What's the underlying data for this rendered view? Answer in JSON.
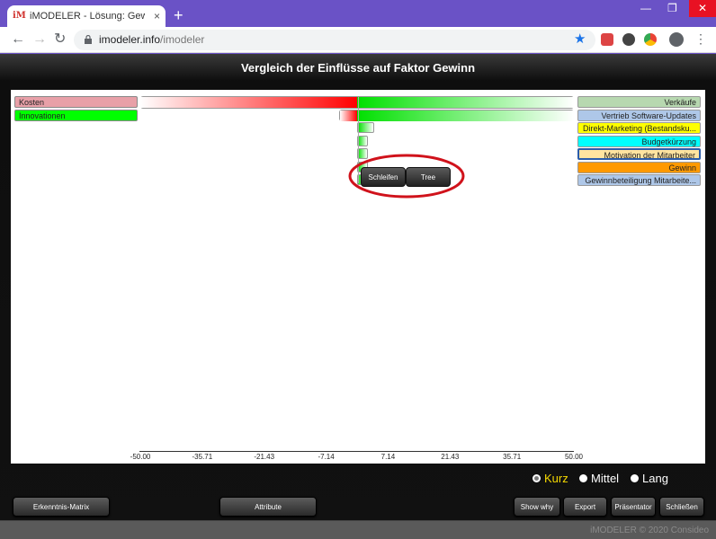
{
  "browser": {
    "tab_title": "iMODELER - Lösung: Gewinn (Ge",
    "tab_close": "×",
    "new_tab": "+",
    "url_host": "imodeler.info",
    "url_path": "/imodeler",
    "favicon_text": "iM"
  },
  "app": {
    "title": "Vergleich der Einflüsse auf Faktor Gewinn",
    "left_labels": [
      {
        "label": "Kosten",
        "color": "#e8a0a8"
      },
      {
        "label": "Innovationen",
        "color": "#00ff00"
      }
    ],
    "right_labels": [
      {
        "label": "Verkäufe",
        "color": "#b7d8b0"
      },
      {
        "label": "Vertrieb Software-Updates",
        "color": "#aec7e8"
      },
      {
        "label": "Direkt-Marketing (Bestandsku...",
        "color": "#ffff00"
      },
      {
        "label": "Budgetkürzung",
        "color": "#00ffff"
      },
      {
        "label": "Motivation der Mitarbeiter",
        "color": "#ffe4a0"
      },
      {
        "label": "Gewinn",
        "color": "#ff9900"
      },
      {
        "label": "Gewinnbeteiligung Mitarbeite...",
        "color": "#aec7e8"
      }
    ],
    "context_buttons": [
      "Schleifen",
      "Tree"
    ],
    "timeframes": [
      {
        "label": "Kurz",
        "selected": true
      },
      {
        "label": "Mittel",
        "selected": false
      },
      {
        "label": "Lang",
        "selected": false
      }
    ],
    "buttons": {
      "matrix": "Erkenntnis-Matrix",
      "attribute": "Attribute",
      "show_why": "Show why",
      "export": "Export",
      "presenter": "Präsentator",
      "close": "Schließen"
    },
    "footer": "iMODELER © 2020 Consideo"
  },
  "chart_data": {
    "type": "bar",
    "orientation": "horizontal",
    "xlim": [
      -50.0,
      50.0
    ],
    "tick_labels": [
      "-50.00",
      "-35.71",
      "-21.43",
      "-7.14",
      "7.14",
      "21.43",
      "35.71",
      "50.00"
    ],
    "negative_series": {
      "categories": [
        "Kosten",
        "Innovationen"
      ],
      "values": [
        -50.0,
        -4.0
      ]
    },
    "positive_series": {
      "categories": [
        "Verkäufe",
        "Vertrieb Software-Updates",
        "Direkt-Marketing (Bestandsku...",
        "Budgetkürzung",
        "Motivation der Mitarbeiter",
        "Gewinn",
        "Gewinnbeteiligung Mitarbeite..."
      ],
      "values": [
        50.0,
        50.0,
        4.0,
        2.5,
        2.5,
        2.5,
        2.0
      ]
    }
  }
}
